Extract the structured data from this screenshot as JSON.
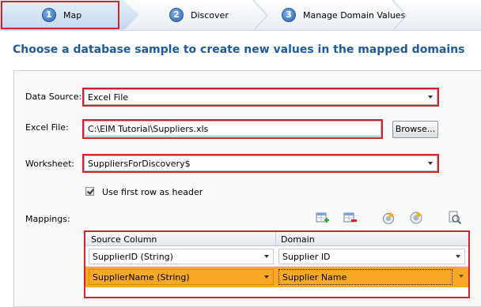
{
  "wizard": {
    "steps": [
      {
        "number": "1",
        "label": "Map"
      },
      {
        "number": "2",
        "label": "Discover"
      },
      {
        "number": "3",
        "label": "Manage Domain Values"
      }
    ]
  },
  "page": {
    "title": "Choose a database sample to create new values in the mapped domains"
  },
  "form": {
    "data_source": {
      "label": "Data Source:",
      "value": "Excel File"
    },
    "excel_file": {
      "label": "Excel File:",
      "value": "C:\\EIM Tutorial\\Suppliers.xls",
      "browse_label": "Browse..."
    },
    "worksheet": {
      "label": "Worksheet:",
      "value": "SuppliersForDiscovery$"
    },
    "first_row_header": {
      "label": "Use first row as header",
      "checked": true
    },
    "mappings_label": "Mappings:"
  },
  "mappings": {
    "columns": [
      "Source Column",
      "Domain"
    ],
    "rows": [
      {
        "source": "SupplierID (String)",
        "domain": "Supplier ID"
      },
      {
        "source": "SupplierName (String)",
        "domain": "Supplier Name"
      }
    ]
  },
  "toolbar_icons": [
    "add-column-mapping-icon",
    "remove-column-mapping-icon",
    "create-domain-icon",
    "view-domains-icon",
    "preview-data-icon"
  ],
  "colors": {
    "accent_blue": "#1e5a9c",
    "highlight_red": "#d0242c",
    "selected_row": "#f7a824"
  }
}
